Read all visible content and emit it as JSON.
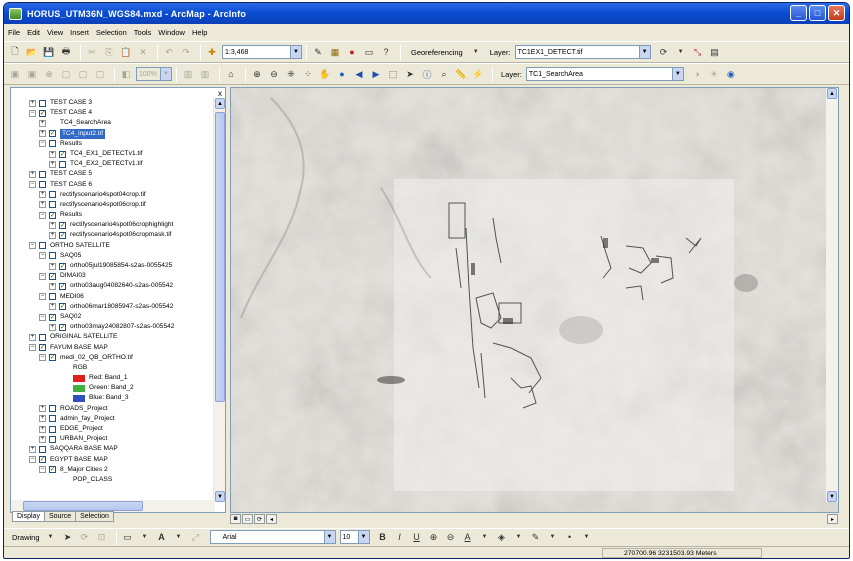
{
  "window": {
    "title": "HORUS_UTM36N_WGS84.mxd - ArcMap - ArcInfo",
    "buttons": {
      "minimize": "_",
      "maximize": "□",
      "close": "✕"
    }
  },
  "menu": [
    "File",
    "Edit",
    "View",
    "Insert",
    "Selection",
    "Tools",
    "Window",
    "Help"
  ],
  "toolbar1": {
    "scale": "1:3,468",
    "georeferencing_label": "Georeferencing",
    "layer_label": "Layer:",
    "layer_value": "TC1EX1_DETECT.tif"
  },
  "toolbar2": {
    "zoom_value": "100%",
    "layer_label": "Layer:",
    "layer_value": "TC1_SearchArea"
  },
  "toc": {
    "close_glyph": "x",
    "rows": [
      {
        "label": "TEST CASE 3",
        "toggle": "+",
        "checked": false,
        "level": 1
      },
      {
        "label": "TEST CASE 4",
        "toggle": "−",
        "checked": true,
        "level": 1
      },
      {
        "label": "TC4_SearchArea",
        "toggle": "+",
        "checked": null,
        "level": 2
      },
      {
        "label": "TC4_input2.tif",
        "toggle": "+",
        "checked": true,
        "level": 2,
        "selected": true
      },
      {
        "label": "Results",
        "toggle": "−",
        "checked": false,
        "level": 2
      },
      {
        "label": "TC4_EX1_DETECTv1.tif",
        "toggle": "+",
        "checked": true,
        "level": 3
      },
      {
        "label": "TC4_EX2_DETECTv1.tif",
        "toggle": "+",
        "checked": false,
        "level": 3
      },
      {
        "label": "TEST CASE 5",
        "toggle": "+",
        "checked": false,
        "level": 1
      },
      {
        "label": "TEST CASE 6",
        "toggle": "−",
        "checked": false,
        "level": 1
      },
      {
        "label": "rectifyscenario4spot04crop.tif",
        "toggle": "+",
        "checked": false,
        "level": 2
      },
      {
        "label": "rectifyscenario4spot06crop.tif",
        "toggle": "+",
        "checked": false,
        "level": 2
      },
      {
        "label": "Results",
        "toggle": "−",
        "checked": true,
        "level": 2
      },
      {
        "label": "rectifyscenario4spot06crophighlight",
        "toggle": "+",
        "checked": true,
        "level": 3
      },
      {
        "label": "rectifyscenario4spot06cropmask.tif",
        "toggle": "+",
        "checked": true,
        "level": 3
      },
      {
        "label": "ORTHO SATELLITE",
        "toggle": "−",
        "checked": false,
        "level": 1
      },
      {
        "label": "SAQ05",
        "toggle": "−",
        "checked": false,
        "level": 2
      },
      {
        "label": "ortho05jul19085854-s2as-0055425",
        "toggle": "+",
        "checked": true,
        "level": 3
      },
      {
        "label": "DIMAI03",
        "toggle": "−",
        "checked": true,
        "level": 2
      },
      {
        "label": "ortho03aug04082640-s2as-005542",
        "toggle": "+",
        "checked": true,
        "level": 3
      },
      {
        "label": "MEDI06",
        "toggle": "−",
        "checked": false,
        "level": 2
      },
      {
        "label": "ortho06mar18085947-s2as-005542",
        "toggle": "+",
        "checked": true,
        "level": 3
      },
      {
        "label": "SAQ02",
        "toggle": "−",
        "checked": true,
        "level": 2
      },
      {
        "label": "ortho03may24082807-s2as-005542",
        "toggle": "+",
        "checked": true,
        "level": 3
      },
      {
        "label": "ORIGINAL SATELLITE",
        "toggle": "+",
        "checked": false,
        "level": 1
      },
      {
        "label": "FAYUM BASE MAP",
        "toggle": "−",
        "checked": true,
        "level": 1
      },
      {
        "label": "medi_02_QB_ORTHO.tif",
        "toggle": "−",
        "checked": true,
        "level": 2
      },
      {
        "label": "RGB",
        "toggle": null,
        "checked": null,
        "level": 4
      },
      {
        "label": "Red:   Band_1",
        "toggle": null,
        "checked": null,
        "level": 4,
        "swatch": "#e02020"
      },
      {
        "label": "Green: Band_2",
        "toggle": null,
        "checked": null,
        "level": 4,
        "swatch": "#40b040"
      },
      {
        "label": "Blue:  Band_3",
        "toggle": null,
        "checked": null,
        "level": 4,
        "swatch": "#3050c0"
      },
      {
        "label": "ROADS_Project",
        "toggle": "+",
        "checked": false,
        "level": 2
      },
      {
        "label": "admin_fay_Project",
        "toggle": "+",
        "checked": false,
        "level": 2
      },
      {
        "label": "EDGE_Project",
        "toggle": "+",
        "checked": false,
        "level": 2
      },
      {
        "label": "URBAN_Project",
        "toggle": "+",
        "checked": false,
        "level": 2
      },
      {
        "label": "SAQQARA BASE MAP",
        "toggle": "+",
        "checked": false,
        "level": 1
      },
      {
        "label": "EGYPT BASE MAP",
        "toggle": "−",
        "checked": true,
        "level": 1
      },
      {
        "label": "8_Major Cities 2",
        "toggle": "−",
        "checked": true,
        "level": 2
      },
      {
        "label": "POP_CLASS",
        "toggle": null,
        "checked": null,
        "level": 4
      }
    ]
  },
  "toc_tabs": [
    "Display",
    "Source",
    "Selection"
  ],
  "drawing": {
    "label": "Drawing",
    "font": "Arial",
    "font_size": "10"
  },
  "status": {
    "coords": "270700.96  3231503.93 Meters"
  },
  "colors": {
    "titlebar": "#0a4ed3",
    "window_bg": "#ece9d8",
    "selection": "#316ac5"
  }
}
